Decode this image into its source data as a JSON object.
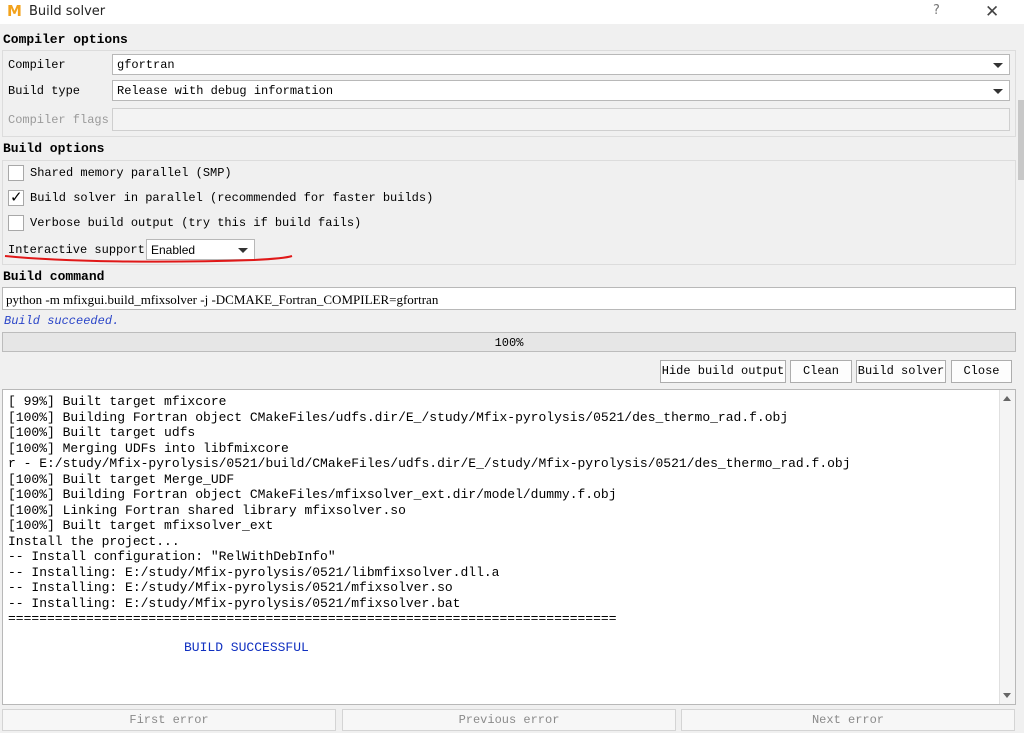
{
  "window": {
    "title": "Build solver",
    "help": "?",
    "close": "✕",
    "logo": "M"
  },
  "compiler_options": {
    "title": "Compiler options",
    "compiler_label": "Compiler",
    "compiler_value": "gfortran",
    "build_type_label": "Build type",
    "build_type_value": "Release with debug information",
    "flags_label": "Compiler flags",
    "flags_value": ""
  },
  "build_options": {
    "title": "Build options",
    "smp": {
      "label": "Shared memory parallel (SMP)",
      "checked": false
    },
    "parallel": {
      "label": "Build solver in parallel (recommended for faster builds)",
      "checked": true
    },
    "verbose": {
      "label": "Verbose build output (try this if build fails)",
      "checked": false
    },
    "interactive_label": "Interactive support",
    "interactive_value": "Enabled",
    "check_mark": "✓"
  },
  "build_command": {
    "title": "Build command",
    "value": "python -m mfixgui.build_mfixsolver -j -DCMAKE_Fortran_COMPILER=gfortran"
  },
  "status": "Build succeeded.",
  "progress": {
    "value": 100,
    "label": "100%"
  },
  "buttons": {
    "hide_output": "Hide build output",
    "clean": "Clean",
    "build": "Build solver",
    "close": "Close"
  },
  "output_lines": [
    "[ 99%] Built target mfixcore",
    "[100%] Building Fortran object CMakeFiles/udfs.dir/E_/study/Mfix-pyrolysis/0521/des_thermo_rad.f.obj",
    "[100%] Built target udfs",
    "[100%] Merging UDFs into libfmixcore",
    "r - E:/study/Mfix-pyrolysis/0521/build/CMakeFiles/udfs.dir/E_/study/Mfix-pyrolysis/0521/des_thermo_rad.f.obj",
    "[100%] Built target Merge_UDF",
    "[100%] Building Fortran object CMakeFiles/mfixsolver_ext.dir/model/dummy.f.obj",
    "[100%] Linking Fortran shared library mfixsolver.so",
    "[100%] Built target mfixsolver_ext",
    "Install the project...",
    "-- Install configuration: \"RelWithDebInfo\"",
    "-- Installing: E:/study/Mfix-pyrolysis/0521/libmfixsolver.dll.a",
    "-- Installing: E:/study/Mfix-pyrolysis/0521/mfixsolver.so",
    "-- Installing: E:/study/Mfix-pyrolysis/0521/mfixsolver.bat",
    "=============================================================================="
  ],
  "output_success": "BUILD SUCCESSFUL",
  "nav": {
    "first": "First error",
    "previous": "Previous error",
    "next": "Next error"
  }
}
